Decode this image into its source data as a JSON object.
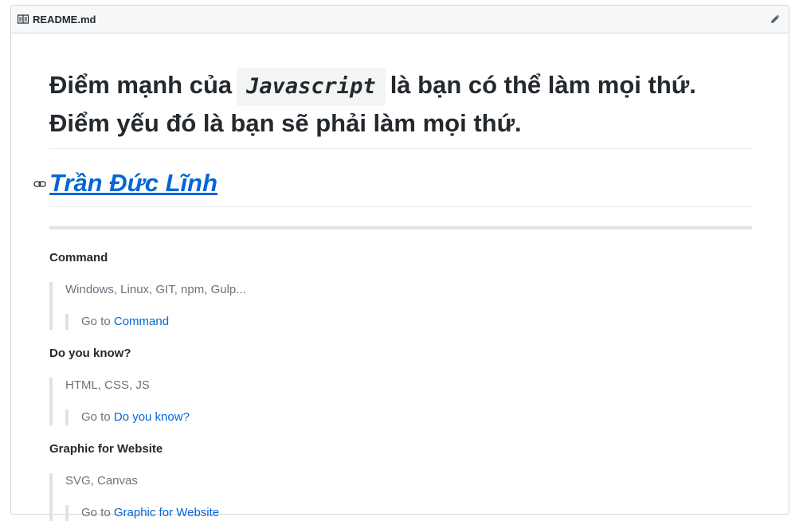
{
  "file": {
    "name": "README.md",
    "icon": "book-icon",
    "edit_icon": "pencil-icon"
  },
  "tagline": {
    "part1": "Điểm mạnh của",
    "code": "Javascript",
    "part2": "là bạn có thể làm mọi thứ.",
    "line2": "Điểm yếu đó là bạn sẽ phải làm mọi thứ."
  },
  "author": {
    "name": "Trần Đức Lĩnh",
    "anchor_icon": "link-icon"
  },
  "sections": [
    {
      "title": "Command",
      "desc": "Windows, Linux, GIT, npm, Gulp...",
      "goto": "Go to",
      "link": "Command"
    },
    {
      "title": "Do you know?",
      "desc": "HTML, CSS, JS",
      "goto": "Go to",
      "link": "Do you know?"
    },
    {
      "title": "Graphic for Website",
      "desc": "SVG, Canvas",
      "goto": "Go to",
      "link": "Graphic for Website"
    }
  ],
  "colors": {
    "link": "#0366d6",
    "text": "#24292e",
    "muted": "#6a737d",
    "header_bg": "#f6f8fa",
    "border": "#d1d5da"
  }
}
